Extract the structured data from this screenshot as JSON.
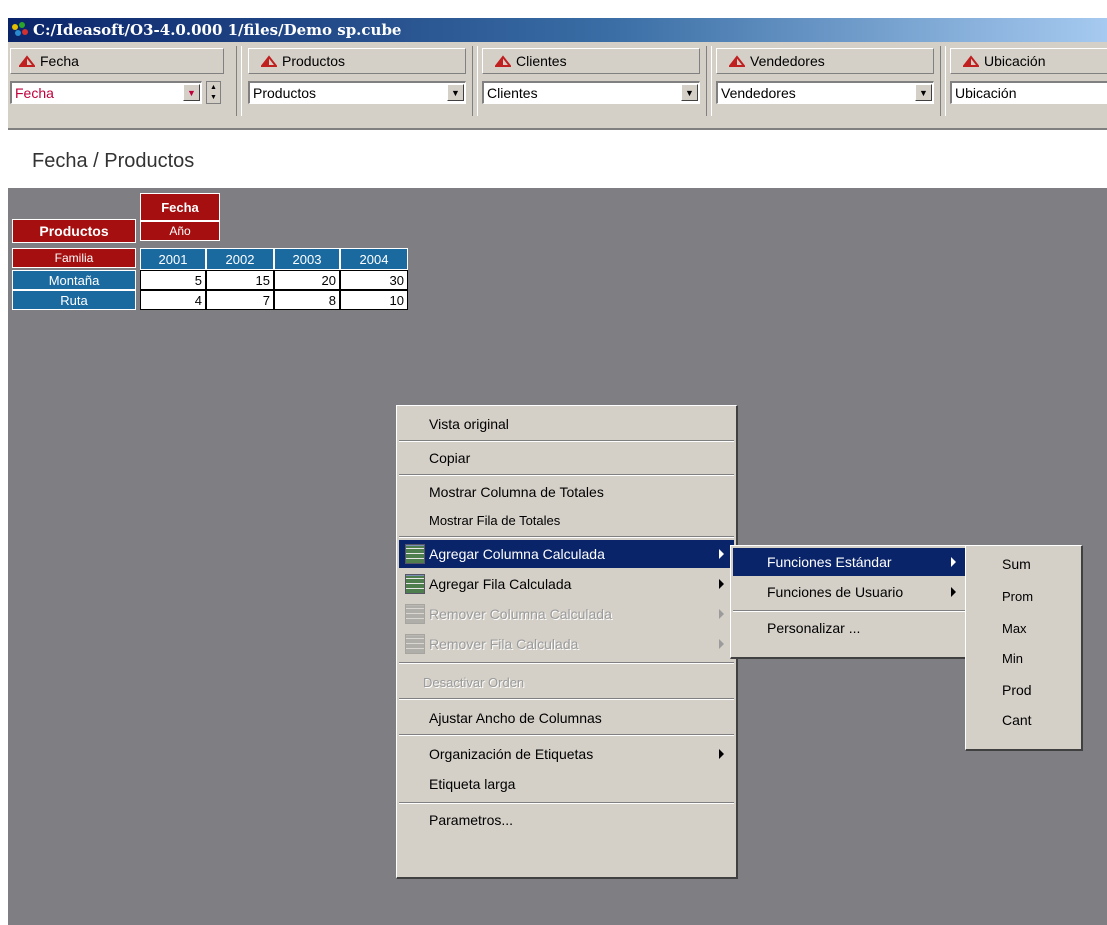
{
  "window": {
    "title": "C:/Ideasoft/O3-4.0.000  1/files/Demo  sp.cube"
  },
  "dimensions": [
    {
      "button_label": "Fecha",
      "select_value": "Fecha",
      "select_color": "#c0003c"
    },
    {
      "button_label": "Productos",
      "select_value": "Productos"
    },
    {
      "button_label": "Clientes",
      "select_value": "Clientes"
    },
    {
      "button_label": "Vendedores",
      "select_value": "Vendedores"
    },
    {
      "button_label": "Ubicación",
      "select_value": "Ubicación"
    }
  ],
  "view": {
    "title": "Fecha / Productos"
  },
  "pivot": {
    "col_dimension": "Fecha",
    "col_level": "Año",
    "row_dimension": "Productos",
    "row_level": "Familia",
    "columns": [
      "2001",
      "2002",
      "2003",
      "2004"
    ],
    "rows": [
      {
        "label": "Montaña",
        "values": [
          "5",
          "15",
          "20",
          "30"
        ]
      },
      {
        "label": "Ruta",
        "values": [
          "4",
          "7",
          "8",
          "10"
        ]
      }
    ]
  },
  "context_menu": {
    "items": [
      {
        "label": "Vista original"
      },
      {
        "label": "Copiar"
      },
      {
        "label": "Mostrar Columna de Totales"
      },
      {
        "label": "Mostrar Fila de Totales"
      },
      {
        "label": "Agregar Columna Calculada"
      },
      {
        "label": "Agregar Fila Calculada"
      },
      {
        "label": "Remover Columna Calculada"
      },
      {
        "label": "Remover Fila Calculada"
      },
      {
        "label": "Desactivar Orden"
      },
      {
        "label": "Ajustar Ancho de Columnas"
      },
      {
        "label": "Organización de Etiquetas"
      },
      {
        "label": "Etiqueta larga"
      },
      {
        "label": "Parametros..."
      }
    ]
  },
  "submenu": {
    "items": [
      {
        "label": "Funciones Estándar"
      },
      {
        "label": "Funciones de Usuario"
      },
      {
        "label": "Personalizar ..."
      }
    ]
  },
  "functions_menu": {
    "items": [
      "Sum",
      "Prom",
      "Max",
      "Min",
      "Prod",
      "Cant"
    ]
  },
  "colors": {
    "highlight": "#0a246a",
    "header_red": "#a50f0f",
    "header_blue": "#1a6aa0",
    "canvas": "#7f7e82"
  }
}
